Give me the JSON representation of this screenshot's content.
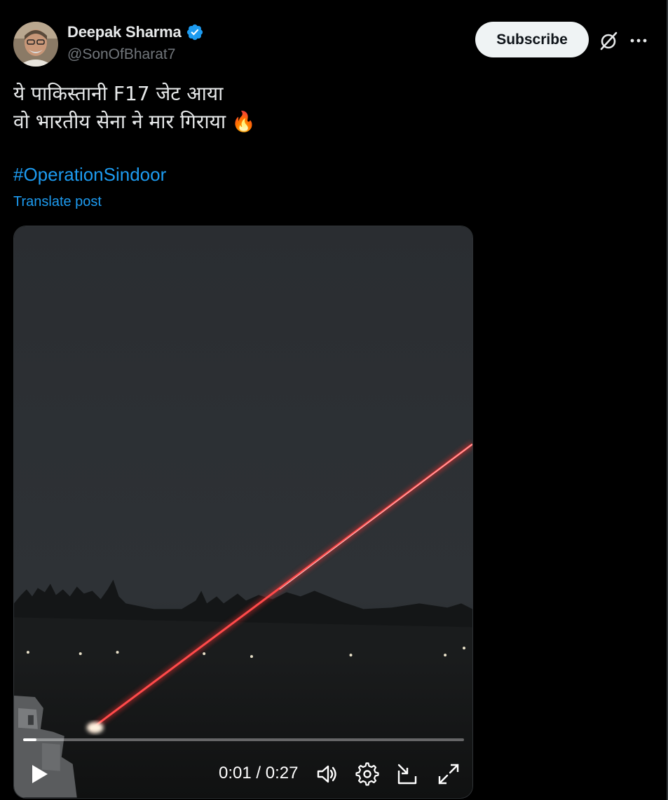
{
  "author": {
    "display_name": "Deepak Sharma",
    "handle": "@SonOfBharat7",
    "verified": true
  },
  "actions": {
    "subscribe_label": "Subscribe"
  },
  "post": {
    "line1": "ये पाकिस्तानी F17 जेट आया",
    "line2": "वो भारतीय सेना ने मार गिराया",
    "emoji": "🔥",
    "hashtag": "#OperationSindoor",
    "translate_label": "Translate post"
  },
  "video": {
    "current_time": "0:01",
    "separator": "/",
    "duration": "0:27",
    "progress_fraction": 0.03,
    "icons": [
      "play-icon",
      "volume-icon",
      "settings-icon",
      "pip-icon",
      "fullscreen-icon"
    ]
  },
  "colors": {
    "link": "#1d9bf0",
    "verified_badge": "#1d9bf0",
    "subscribe_bg": "#eff3f4",
    "muted_text": "#71767b",
    "laser": "#ff3a3a"
  }
}
